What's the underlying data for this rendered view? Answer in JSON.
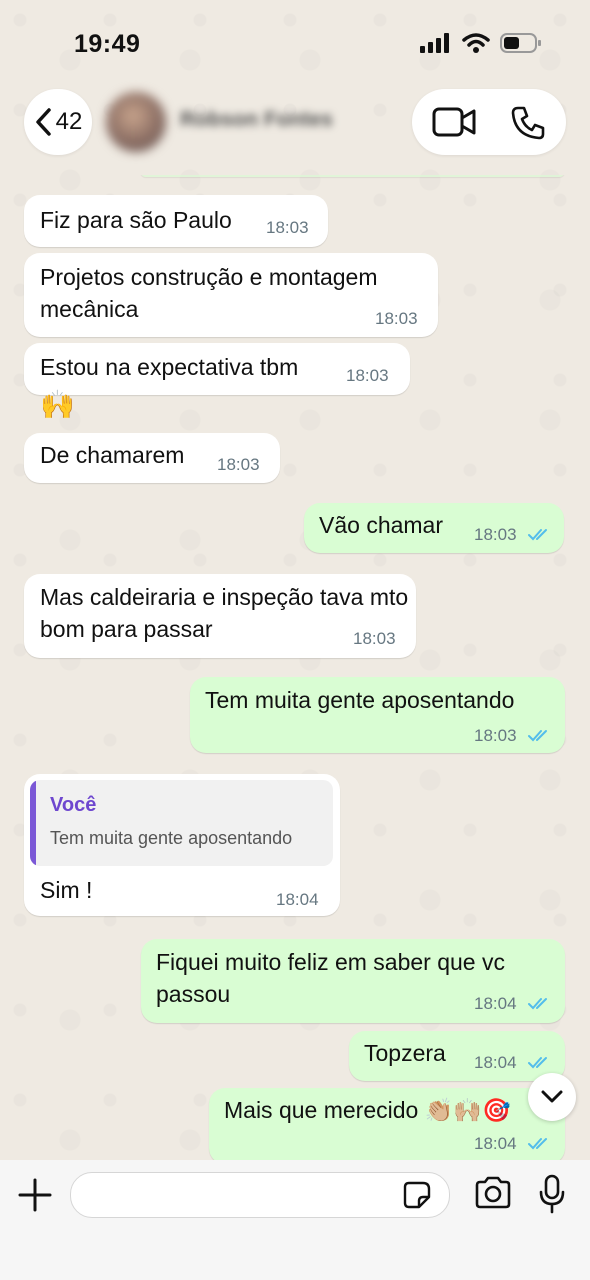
{
  "status_bar": {
    "time": "19:49"
  },
  "header": {
    "back_count": "42",
    "contact_name": "Robson Fontes"
  },
  "messages": [
    {
      "text": "Fiz para são Paulo",
      "time": "18:03"
    },
    {
      "text": "Projetos construção e montagem mecânica",
      "time": "18:03"
    },
    {
      "text": "Estou na expectativa tbm",
      "time": "18:03"
    },
    {
      "text": "🙌"
    },
    {
      "text": "De chamarem",
      "time": "18:03"
    },
    {
      "text": "Vão chamar",
      "time": "18:03"
    },
    {
      "text": "Mas caldeiraria e inspeção tava mto bom para passar",
      "time": "18:03"
    },
    {
      "text": "Tem muita gente aposentando",
      "time": "18:03"
    },
    {
      "quote_author": "Você",
      "quote_text": "Tem muita gente aposentando",
      "text": "Sim !",
      "time": "18:04"
    },
    {
      "text": "Fiquei muito feliz em saber que vc passou",
      "time": "18:04"
    },
    {
      "text": "Topzera",
      "time": "18:04"
    },
    {
      "text": "Mais que merecido 👏🏼🙌🏼🎯",
      "time": "18:04"
    }
  ],
  "composer": {
    "placeholder": ""
  },
  "colors": {
    "outgoing_bubble": "#d9fdd3",
    "incoming_bubble": "#ffffff",
    "read_ticks": "#53bdeb",
    "quote_accent": "#7b58d6"
  }
}
